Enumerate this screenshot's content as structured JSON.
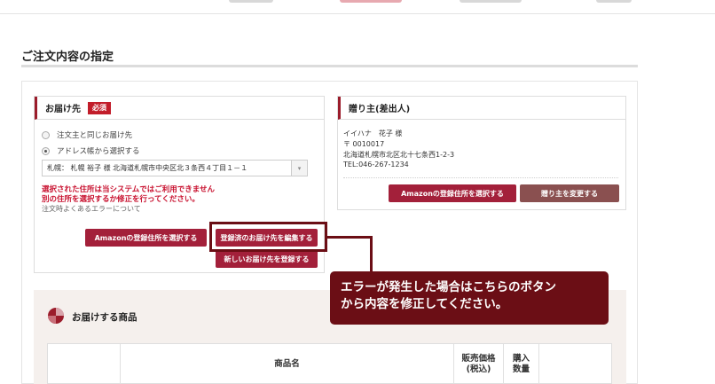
{
  "page": {
    "title": "ご注文内容の指定"
  },
  "delivery": {
    "header": "お届け先",
    "required_badge": "必須",
    "option_same": "注文主と同じお届け先",
    "option_addressbook": "アドレス帳から選択する",
    "selected_address": "札幌：  札幌 裕子 様 北海道札幌市中央区北３条西４丁目１－１",
    "error_line1": "選択された住所は当システムではご利用できません",
    "error_line2": "別の住所を選択するか修正を行ってください。",
    "note": "注文時よくあるエラーについて",
    "btn_amazon": "Amazonの登録住所を選択する",
    "btn_edit": "登録済のお届け先を編集する",
    "btn_new": "新しいお届け先を登録する"
  },
  "sender": {
    "header": "贈り主(差出人)",
    "name": "イイハナ　花子 様",
    "postal": "〒 0010017",
    "address": "北海道札幌市北区北十七条西1-2-3",
    "tel": "TEL:046-267-1234",
    "btn_amazon": "Amazonの登録住所を選択する",
    "btn_change": "贈り主を変更する"
  },
  "callout": {
    "line1": "エラーが発生した場合はこちらのボタン",
    "line2": "から内容を修正してください。"
  },
  "items": {
    "title": "お届けする商品",
    "col_product": "商品名",
    "col_price_1": "販売価格",
    "col_price_2": "(税込)",
    "col_qty_1": "購入",
    "col_qty_2": "数量"
  },
  "colors": {
    "brand_red": "#a3203a",
    "brown": "#8a5050",
    "dark_maroon": "#6b0e15",
    "error_red": "#c8102e"
  }
}
